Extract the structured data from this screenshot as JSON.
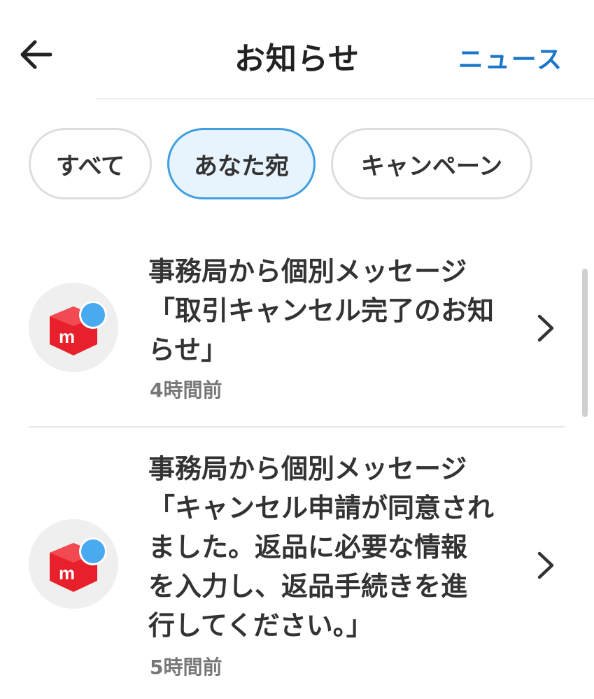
{
  "header": {
    "title": "お知らせ",
    "news_label": "ニュース",
    "back_icon": "arrow-left-icon"
  },
  "tabs": [
    {
      "label": "すべて",
      "selected": false
    },
    {
      "label": "あなた宛",
      "selected": true
    },
    {
      "label": "キャンペーン",
      "selected": false
    }
  ],
  "notifications": [
    {
      "lines": [
        "事務局から個別メッセージ",
        "「取引キャンセル完了のお知",
        "らせ」"
      ],
      "time": "4時間前",
      "unread": true,
      "icon": "mercari-logo-icon"
    },
    {
      "lines": [
        "事務局から個別メッセージ",
        "「キャンセル申請が同意され",
        "ました。返品に必要な情報",
        "を入力し、返品手続きを進",
        "行してください。」"
      ],
      "time": "5時間前",
      "unread": true,
      "icon": "mercari-logo-icon"
    }
  ],
  "colors": {
    "accent": "#1a76c8",
    "selected_tab_bg": "#e8f4fd",
    "selected_tab_border": "#3f9de0",
    "brand_red": "#e8202b",
    "unread_dot": "#4aaaf0"
  }
}
